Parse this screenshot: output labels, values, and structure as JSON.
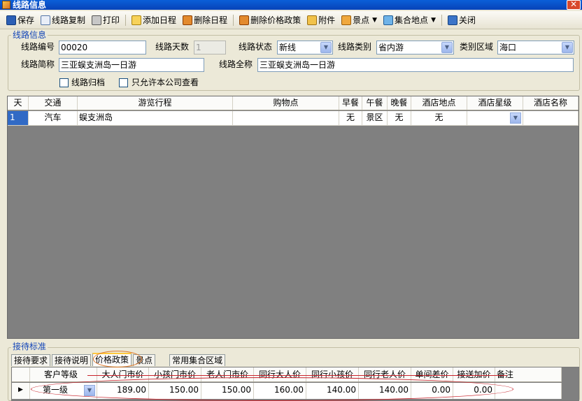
{
  "window": {
    "title": "线路信息",
    "close_glyph": "✕"
  },
  "toolbar": [
    {
      "name": "save",
      "icon": "save-icon",
      "label": "保存"
    },
    {
      "name": "copy-route",
      "icon": "copy-icon",
      "label": "线路复制"
    },
    {
      "name": "print",
      "icon": "printer-icon",
      "label": "打印"
    },
    {
      "name": "add-schedule",
      "icon": "add-schedule-icon",
      "label": "添加日程"
    },
    {
      "name": "delete-schedule",
      "icon": "delete-schedule-icon",
      "label": "删除日程"
    },
    {
      "name": "delete-price-policy",
      "icon": "delete-policy-icon",
      "label": "删除价格政策"
    },
    {
      "name": "attachment",
      "icon": "folder-icon",
      "label": "附件"
    },
    {
      "name": "scenic",
      "icon": "scenic-spot-icon",
      "label": "景点"
    },
    {
      "name": "meeting-point",
      "icon": "meeting-point-icon",
      "label": "集合地点"
    },
    {
      "name": "close",
      "icon": "close-window-icon",
      "label": "关闭"
    }
  ],
  "route_info": {
    "legend": "线路信息",
    "code_label": "线路编号",
    "code_value": "00020",
    "days_label": "线路天数",
    "days_value": "1",
    "status_label": "线路状态",
    "status_value": "新线",
    "category_label": "线路类别",
    "category_value": "省内游",
    "region_label": "类别区域",
    "region_value": "海口",
    "short_name_label": "线路简称",
    "short_name_value": "三亚蜈支洲岛一日游",
    "full_name_label": "线路全称",
    "full_name_value": "三亚蜈支洲岛一日游",
    "archive_label": "线路归档",
    "company_only_label": "只允许本公司查看"
  },
  "schedule": {
    "columns": [
      "天",
      "交通",
      "游览行程",
      "购物点",
      "早餐",
      "午餐",
      "晚餐",
      "酒店地点",
      "酒店星级",
      "酒店名称"
    ],
    "rows": [
      {
        "day": "1",
        "transport": "汽车",
        "itinerary": "蜈支洲岛",
        "shopping": "",
        "breakfast": "无",
        "lunch": "景区",
        "dinner": "无",
        "hotel_location": "无",
        "hotel_star": "",
        "hotel_name": ""
      }
    ]
  },
  "reception": {
    "legend": "接待标准",
    "tabs": [
      "接待要求",
      "接待说明",
      "价格政策",
      "景点",
      "常用集合区域"
    ],
    "active_tab": "价格政策",
    "price_columns": [
      "客户等级",
      "大人门市价",
      "小孩门市价",
      "老人门市价",
      "同行大人价",
      "同行小孩价",
      "同行老人价",
      "单间差价",
      "接送加价",
      "备注"
    ],
    "price_rows": [
      {
        "level": "第一级",
        "adult": "189.00",
        "child": "150.00",
        "senior": "150.00",
        "peer_adult": "160.00",
        "peer_child": "140.00",
        "peer_senior": "140.00",
        "single_supplement": "0.00",
        "transfer": "0.00",
        "remark": ""
      }
    ]
  },
  "colors": {
    "accent": "#1446b8",
    "selection": "#316ac5",
    "annotation": "#c8232c"
  }
}
